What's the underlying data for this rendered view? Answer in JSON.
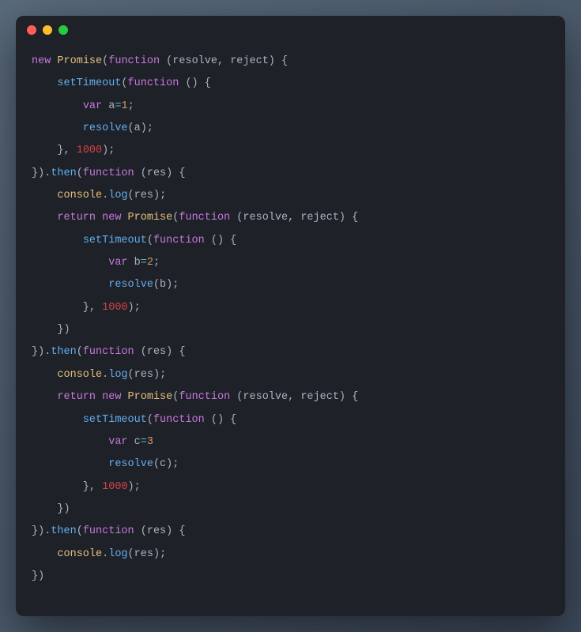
{
  "titlebar": {
    "buttons": [
      "close",
      "minimize",
      "maximize"
    ]
  },
  "code": {
    "tokens": [
      [
        {
          "t": "kw",
          "v": "new"
        },
        {
          "t": "punc",
          "v": " "
        },
        {
          "t": "cls",
          "v": "Promise"
        },
        {
          "t": "punc",
          "v": "("
        },
        {
          "t": "kw",
          "v": "function"
        },
        {
          "t": "punc",
          "v": " ("
        },
        {
          "t": "param",
          "v": "resolve"
        },
        {
          "t": "punc",
          "v": ", "
        },
        {
          "t": "param",
          "v": "reject"
        },
        {
          "t": "punc",
          "v": ") {"
        }
      ],
      [
        {
          "t": "punc",
          "v": "    "
        },
        {
          "t": "fn",
          "v": "setTimeout"
        },
        {
          "t": "punc",
          "v": "("
        },
        {
          "t": "kw",
          "v": "function"
        },
        {
          "t": "punc",
          "v": " () {"
        }
      ],
      [
        {
          "t": "punc",
          "v": "        "
        },
        {
          "t": "kw",
          "v": "var"
        },
        {
          "t": "punc",
          "v": " "
        },
        {
          "t": "param",
          "v": "a"
        },
        {
          "t": "op",
          "v": "="
        },
        {
          "t": "num",
          "v": "1"
        },
        {
          "t": "punc",
          "v": ";"
        }
      ],
      [
        {
          "t": "punc",
          "v": "        "
        },
        {
          "t": "fn",
          "v": "resolve"
        },
        {
          "t": "punc",
          "v": "("
        },
        {
          "t": "param",
          "v": "a"
        },
        {
          "t": "punc",
          "v": ");"
        }
      ],
      [
        {
          "t": "punc",
          "v": "    }, "
        },
        {
          "t": "rednum",
          "v": "1000"
        },
        {
          "t": "punc",
          "v": ");"
        }
      ],
      [
        {
          "t": "punc",
          "v": "})."
        },
        {
          "t": "fn",
          "v": "then"
        },
        {
          "t": "punc",
          "v": "("
        },
        {
          "t": "kw",
          "v": "function"
        },
        {
          "t": "punc",
          "v": " ("
        },
        {
          "t": "param",
          "v": "res"
        },
        {
          "t": "punc",
          "v": ") {"
        }
      ],
      [
        {
          "t": "punc",
          "v": "    "
        },
        {
          "t": "obj",
          "v": "console"
        },
        {
          "t": "punc",
          "v": "."
        },
        {
          "t": "fn",
          "v": "log"
        },
        {
          "t": "punc",
          "v": "("
        },
        {
          "t": "param",
          "v": "res"
        },
        {
          "t": "punc",
          "v": ");"
        }
      ],
      [
        {
          "t": "punc",
          "v": "    "
        },
        {
          "t": "kw",
          "v": "return"
        },
        {
          "t": "punc",
          "v": " "
        },
        {
          "t": "kw",
          "v": "new"
        },
        {
          "t": "punc",
          "v": " "
        },
        {
          "t": "cls",
          "v": "Promise"
        },
        {
          "t": "punc",
          "v": "("
        },
        {
          "t": "kw",
          "v": "function"
        },
        {
          "t": "punc",
          "v": " ("
        },
        {
          "t": "param",
          "v": "resolve"
        },
        {
          "t": "punc",
          "v": ", "
        },
        {
          "t": "param",
          "v": "reject"
        },
        {
          "t": "punc",
          "v": ") {"
        }
      ],
      [
        {
          "t": "punc",
          "v": "        "
        },
        {
          "t": "fn",
          "v": "setTimeout"
        },
        {
          "t": "punc",
          "v": "("
        },
        {
          "t": "kw",
          "v": "function"
        },
        {
          "t": "punc",
          "v": " () {"
        }
      ],
      [
        {
          "t": "punc",
          "v": "            "
        },
        {
          "t": "kw",
          "v": "var"
        },
        {
          "t": "punc",
          "v": " "
        },
        {
          "t": "param",
          "v": "b"
        },
        {
          "t": "op",
          "v": "="
        },
        {
          "t": "num",
          "v": "2"
        },
        {
          "t": "punc",
          "v": ";"
        }
      ],
      [
        {
          "t": "punc",
          "v": "            "
        },
        {
          "t": "fn",
          "v": "resolve"
        },
        {
          "t": "punc",
          "v": "("
        },
        {
          "t": "param",
          "v": "b"
        },
        {
          "t": "punc",
          "v": ");"
        }
      ],
      [
        {
          "t": "punc",
          "v": "        }, "
        },
        {
          "t": "rednum",
          "v": "1000"
        },
        {
          "t": "punc",
          "v": ");"
        }
      ],
      [
        {
          "t": "punc",
          "v": "    })"
        }
      ],
      [
        {
          "t": "punc",
          "v": "})."
        },
        {
          "t": "fn",
          "v": "then"
        },
        {
          "t": "punc",
          "v": "("
        },
        {
          "t": "kw",
          "v": "function"
        },
        {
          "t": "punc",
          "v": " ("
        },
        {
          "t": "param",
          "v": "res"
        },
        {
          "t": "punc",
          "v": ") {"
        }
      ],
      [
        {
          "t": "punc",
          "v": "    "
        },
        {
          "t": "obj",
          "v": "console"
        },
        {
          "t": "punc",
          "v": "."
        },
        {
          "t": "fn",
          "v": "log"
        },
        {
          "t": "punc",
          "v": "("
        },
        {
          "t": "param",
          "v": "res"
        },
        {
          "t": "punc",
          "v": ");"
        }
      ],
      [
        {
          "t": "punc",
          "v": "    "
        },
        {
          "t": "kw",
          "v": "return"
        },
        {
          "t": "punc",
          "v": " "
        },
        {
          "t": "kw",
          "v": "new"
        },
        {
          "t": "punc",
          "v": " "
        },
        {
          "t": "cls",
          "v": "Promise"
        },
        {
          "t": "punc",
          "v": "("
        },
        {
          "t": "kw",
          "v": "function"
        },
        {
          "t": "punc",
          "v": " ("
        },
        {
          "t": "param",
          "v": "resolve"
        },
        {
          "t": "punc",
          "v": ", "
        },
        {
          "t": "param",
          "v": "reject"
        },
        {
          "t": "punc",
          "v": ") {"
        }
      ],
      [
        {
          "t": "punc",
          "v": "        "
        },
        {
          "t": "fn",
          "v": "setTimeout"
        },
        {
          "t": "punc",
          "v": "("
        },
        {
          "t": "kw",
          "v": "function"
        },
        {
          "t": "punc",
          "v": " () {"
        }
      ],
      [
        {
          "t": "punc",
          "v": "            "
        },
        {
          "t": "kw",
          "v": "var"
        },
        {
          "t": "punc",
          "v": " "
        },
        {
          "t": "param",
          "v": "c"
        },
        {
          "t": "op",
          "v": "="
        },
        {
          "t": "num",
          "v": "3"
        }
      ],
      [
        {
          "t": "punc",
          "v": "            "
        },
        {
          "t": "fn",
          "v": "resolve"
        },
        {
          "t": "punc",
          "v": "("
        },
        {
          "t": "param",
          "v": "c"
        },
        {
          "t": "punc",
          "v": ");"
        }
      ],
      [
        {
          "t": "punc",
          "v": "        }, "
        },
        {
          "t": "rednum",
          "v": "1000"
        },
        {
          "t": "punc",
          "v": ");"
        }
      ],
      [
        {
          "t": "punc",
          "v": "    })"
        }
      ],
      [
        {
          "t": "punc",
          "v": "})."
        },
        {
          "t": "fn",
          "v": "then"
        },
        {
          "t": "punc",
          "v": "("
        },
        {
          "t": "kw",
          "v": "function"
        },
        {
          "t": "punc",
          "v": " ("
        },
        {
          "t": "param",
          "v": "res"
        },
        {
          "t": "punc",
          "v": ") {"
        }
      ],
      [
        {
          "t": "punc",
          "v": "    "
        },
        {
          "t": "obj",
          "v": "console"
        },
        {
          "t": "punc",
          "v": "."
        },
        {
          "t": "fn",
          "v": "log"
        },
        {
          "t": "punc",
          "v": "("
        },
        {
          "t": "param",
          "v": "res"
        },
        {
          "t": "punc",
          "v": ");"
        }
      ],
      [
        {
          "t": "punc",
          "v": "})"
        }
      ]
    ]
  }
}
